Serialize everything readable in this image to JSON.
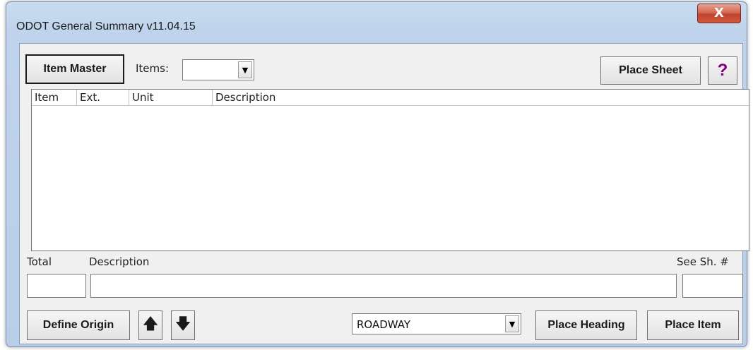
{
  "window": {
    "title": "ODOT General Summary v11.04.15",
    "close_glyph": "X"
  },
  "toolbar": {
    "item_master_label": "Item Master",
    "items_label": "Items:",
    "items_value": "",
    "place_sheet_label": "Place Sheet",
    "help_label": "?"
  },
  "list": {
    "columns": [
      "Item",
      "Ext.",
      "Unit",
      "Description"
    ],
    "rows": []
  },
  "entry": {
    "total_label": "Total",
    "description_label": "Description",
    "see_sheet_label": "See Sh. #",
    "total_value": "",
    "description_value": "",
    "see_sheet_value": ""
  },
  "bottom": {
    "define_origin_label": "Define Origin",
    "up_arrow": "🡅",
    "down_arrow": "🡇",
    "category_value": "ROADWAY",
    "place_heading_label": "Place Heading",
    "place_item_label": "Place Item"
  },
  "colors": {
    "help_accent": "#800080",
    "close_button": "#c2432b"
  }
}
